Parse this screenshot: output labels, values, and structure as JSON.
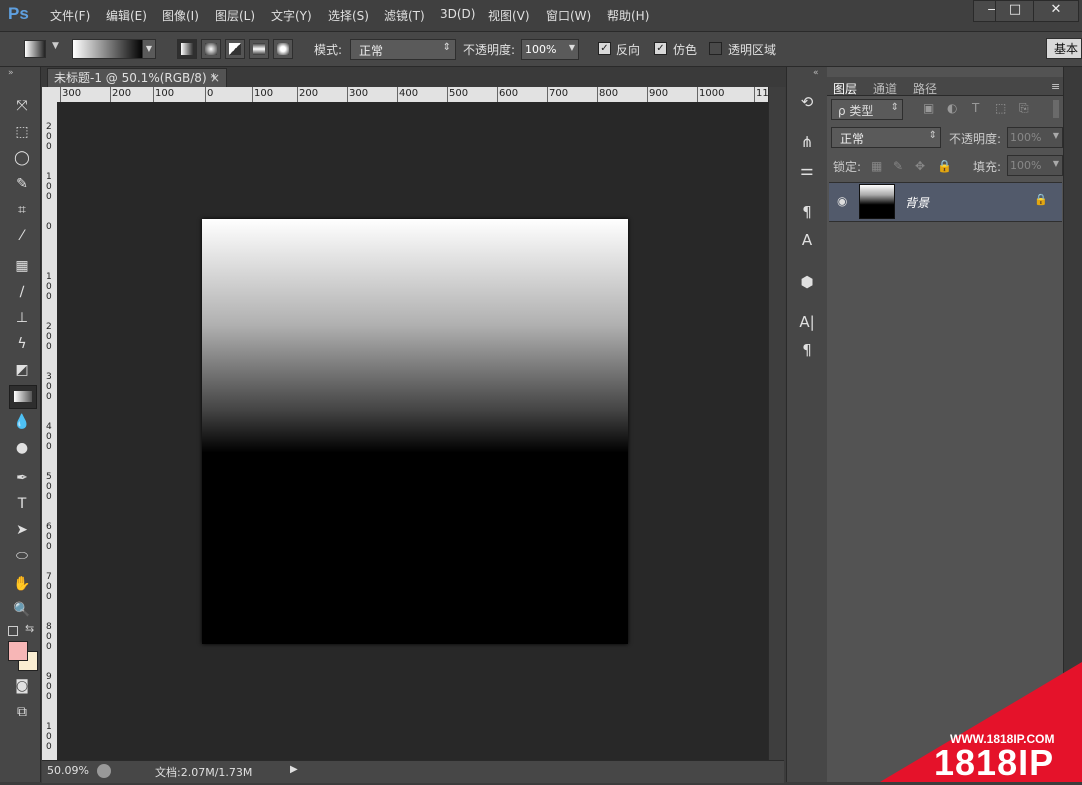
{
  "app": {
    "logo": "Ps"
  },
  "menu": [
    "文件(F)",
    "编辑(E)",
    "图像(I)",
    "图层(L)",
    "文字(Y)",
    "选择(S)",
    "滤镜(T)",
    "3D(D)",
    "视图(V)",
    "窗口(W)",
    "帮助(H)"
  ],
  "window_controls": {
    "minimize": "—",
    "maximize": "□",
    "close": "✕"
  },
  "options": {
    "mode_label": "模式:",
    "mode_value": "正常",
    "opacity_label": "不透明度:",
    "opacity_value": "100%",
    "reverse_label": "反向",
    "dither_label": "仿色",
    "transparency_label": "透明区域",
    "workspace": "基本"
  },
  "document": {
    "tab_title": "未标题-1 @ 50.1%(RGB/8) *",
    "ruler_top": [
      "300",
      "200",
      "100",
      "0",
      "100",
      "200",
      "300",
      "400",
      "500",
      "600",
      "700",
      "800",
      "900",
      "1000",
      "11"
    ],
    "ruler_left": [
      "2\n0\n0",
      "1\n0\n0",
      "0",
      "1\n0\n0",
      "2\n0\n0",
      "3\n0\n0",
      "4\n0\n0",
      "5\n0\n0",
      "6\n0\n0",
      "7\n0\n0",
      "8\n0\n0",
      "9\n0\n0",
      "1\n0\n0"
    ]
  },
  "status": {
    "zoom": "50.09%",
    "doc_info": "文档:2.07M/1.73M"
  },
  "layers_panel": {
    "tabs": [
      "图层",
      "通道",
      "路径"
    ],
    "filter_label": "ρ 类型",
    "blend_mode": "正常",
    "opacity_label": "不透明度:",
    "opacity_value": "100%",
    "lock_label": "锁定:",
    "fill_label": "填充:",
    "fill_value": "100%",
    "layer_name": "背景"
  },
  "colors": {
    "foreground": "#f7b6b6",
    "background": "#fbeed2",
    "selected_layer": "#525a6b"
  },
  "watermark": {
    "url": "WWW.1818IP.COM",
    "brand": "1818IP"
  }
}
